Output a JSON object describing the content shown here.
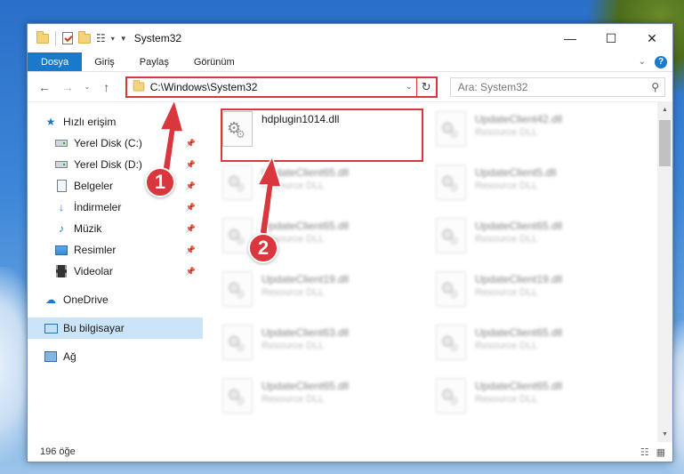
{
  "window": {
    "title": "System32",
    "controls": {
      "minimize": "—",
      "maximize": "☐",
      "close": "✕"
    }
  },
  "ribbon": {
    "tabs": [
      "Dosya",
      "Giriş",
      "Paylaş",
      "Görünüm"
    ],
    "active_tab": "Dosya"
  },
  "navigation": {
    "back": "←",
    "forward": "→",
    "recent": "⌄",
    "up": "↑",
    "address": "C:\\Windows\\System32",
    "search_placeholder": "Ara: System32"
  },
  "sidebar": {
    "quick_access": "Hızlı erişim",
    "items": [
      {
        "label": "Yerel Disk (C:)",
        "icon": "drive-icon"
      },
      {
        "label": "Yerel Disk (D:)",
        "icon": "drive-icon"
      },
      {
        "label": "Belgeler",
        "icon": "documents-icon"
      },
      {
        "label": "İndirmeler",
        "icon": "downloads-icon"
      },
      {
        "label": "Müzik",
        "icon": "music-icon"
      },
      {
        "label": "Resimler",
        "icon": "pictures-icon"
      },
      {
        "label": "Videolar",
        "icon": "videos-icon"
      }
    ],
    "onedrive": "OneDrive",
    "this_pc": "Bu bilgisayar",
    "network": "Ağ"
  },
  "files": [
    {
      "name": "hdplugin1014.dll",
      "type": "",
      "highlighted": true
    },
    {
      "name": "UpdateClient42.dll",
      "type": "Resource DLL"
    },
    {
      "name": "UpdateClient65.dll",
      "type": "Resource DLL"
    },
    {
      "name": "UpdateClient5.dll",
      "type": "Resource DLL"
    },
    {
      "name": "UpdateClient65.dll",
      "type": "Resource DLL"
    },
    {
      "name": "UpdateClient65.dll",
      "type": "Resource DLL"
    },
    {
      "name": "UpdateClient19.dll",
      "type": "Resource DLL"
    },
    {
      "name": "UpdateClient19.dll",
      "type": "Resource DLL"
    },
    {
      "name": "UpdateClient63.dll",
      "type": "Resource DLL"
    },
    {
      "name": "UpdateClient65.dll",
      "type": "Resource DLL"
    },
    {
      "name": "UpdateClient65.dll",
      "type": "Resource DLL"
    },
    {
      "name": "UpdateClient65.dll",
      "type": "Resource DLL"
    }
  ],
  "status": {
    "item_count": "196 öğe"
  },
  "annotations": {
    "step1": "1",
    "step2": "2"
  },
  "colors": {
    "accent": "#1979ca",
    "annotation_red": "#d9363e",
    "selected_bg": "#cce4f7"
  }
}
